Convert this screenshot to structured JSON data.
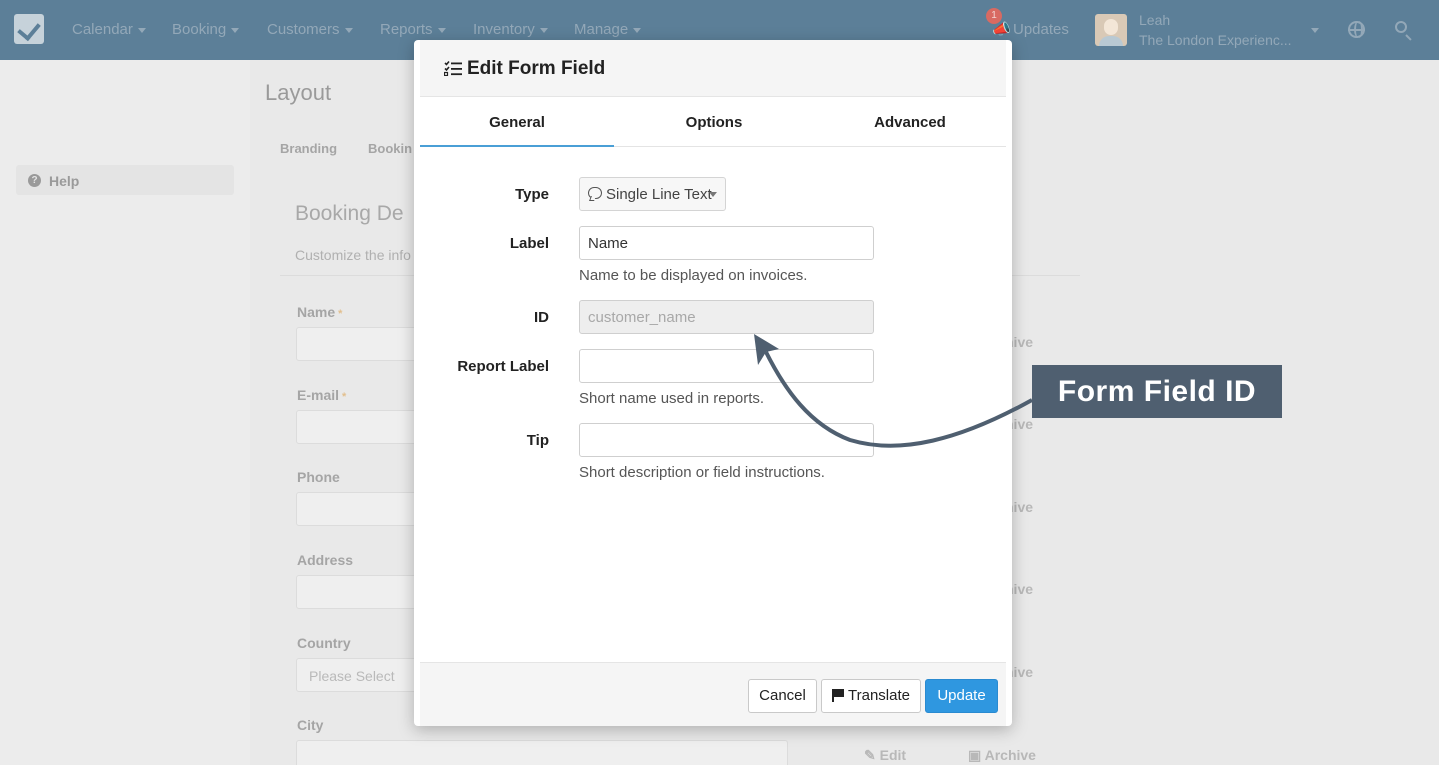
{
  "nav": {
    "items": [
      "Calendar",
      "Booking",
      "Customers",
      "Reports",
      "Inventory",
      "Manage"
    ],
    "updates_badge": "1",
    "updates_label": "Updates",
    "user_name": "Leah",
    "user_org": "The London Experienc..."
  },
  "sidebar": {
    "help_label": "Help"
  },
  "page": {
    "title": "Layout",
    "tabs": [
      "Branding",
      "Bookin"
    ],
    "card_title": "Booking De",
    "card_subtitle": "Customize the info",
    "fields": [
      {
        "label": "Name",
        "required": "*"
      },
      {
        "label": "E-mail",
        "required": "*"
      },
      {
        "label": "Phone",
        "required": ""
      },
      {
        "label": "Address",
        "required": ""
      },
      {
        "label": "Country",
        "required": ""
      },
      {
        "label": "City",
        "required": ""
      }
    ],
    "country_select": "Please Select",
    "archive_fragment": "hive",
    "archive_label": "Archive",
    "edit_label": "Edit"
  },
  "modal": {
    "title": "Edit Form Field",
    "tabs": [
      "General",
      "Options",
      "Advanced"
    ],
    "active_tab": "General",
    "form": {
      "type_label": "Type",
      "type_value": "Single Line Text",
      "label_label": "Label",
      "label_value": "Name",
      "label_help": "Name to be displayed on invoices.",
      "id_label": "ID",
      "id_placeholder": "customer_name",
      "report_label_label": "Report Label",
      "report_label_value": "",
      "report_label_help": "Short name used in reports.",
      "tip_label": "Tip",
      "tip_value": "",
      "tip_help": "Short description or field instructions."
    },
    "buttons": {
      "cancel": "Cancel",
      "translate": "Translate",
      "update": "Update"
    }
  },
  "callout": {
    "text": "Form Field ID"
  },
  "colors": {
    "accent": "#2f97e0",
    "callout_bg": "#4f5f70",
    "tab_underline": "#4a9fd6"
  }
}
